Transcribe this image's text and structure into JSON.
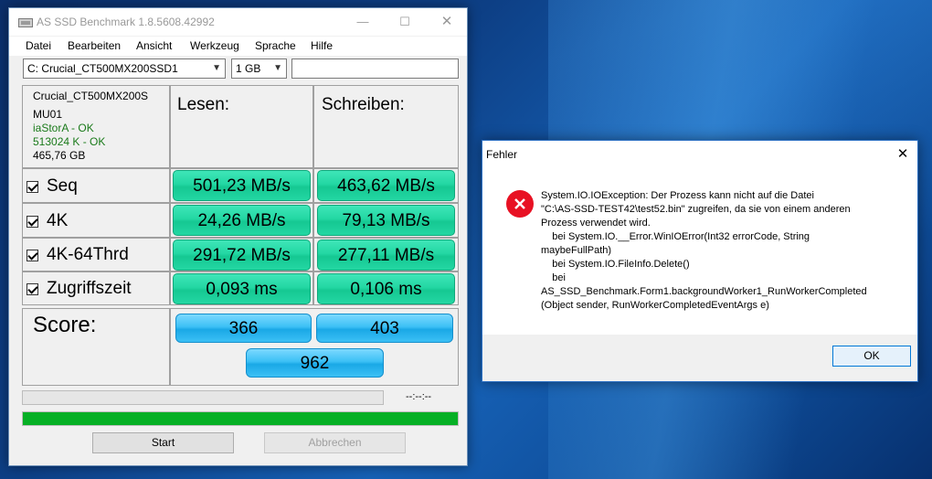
{
  "main_window": {
    "title": "AS SSD Benchmark 1.8.5608.42992",
    "menu": [
      "Datei",
      "Bearbeiten",
      "Ansicht",
      "Werkzeug",
      "Sprache",
      "Hilfe"
    ],
    "drive_select": "C: Crucial_CT500MX200SSD1",
    "size_select": "1 GB",
    "name_field": "",
    "drive_info": {
      "model": "Crucial_CT500MX200S",
      "firmware": "MU01",
      "driver": "iaStorA - OK",
      "alignment": "513024 K - OK",
      "capacity": "465,76 GB"
    },
    "columns": {
      "read": "Lesen:",
      "write": "Schreiben:"
    },
    "rows": [
      {
        "label": "Seq",
        "read": "501,23 MB/s",
        "write": "463,62 MB/s"
      },
      {
        "label": "4K",
        "read": "24,26 MB/s",
        "write": "79,13 MB/s"
      },
      {
        "label": "4K-64Thrd",
        "read": "291,72 MB/s",
        "write": "277,11 MB/s"
      },
      {
        "label": "Zugriffszeit",
        "read": "0,093 ms",
        "write": "0,106 ms"
      }
    ],
    "score": {
      "label": "Score:",
      "read": "366",
      "write": "403",
      "total": "962"
    },
    "elapsed_time": "--:--:--",
    "progress_fraction": 1.0,
    "buttons": {
      "start": "Start",
      "cancel": "Abbrechen"
    }
  },
  "error_dialog": {
    "title": "Fehler",
    "message_lines": [
      "System.IO.IOException: Der Prozess kann nicht auf die Datei",
      "\"C:\\AS-SSD-TEST42\\test52.bin\" zugreifen, da sie von einem anderen",
      "Prozess verwendet wird.",
      "    bei System.IO.__Error.WinIOError(Int32 errorCode, String",
      "maybeFullPath)",
      "    bei System.IO.FileInfo.Delete()",
      "    bei",
      "AS_SSD_Benchmark.Form1.backgroundWorker1_RunWorkerCompleted",
      "(Object sender, RunWorkerCompletedEventArgs e)"
    ],
    "ok_label": "OK"
  },
  "colors": {
    "result_green": "#23d7a3",
    "score_blue": "#3cc0f5",
    "progress_green": "#06b025",
    "error_red": "#e81123",
    "info_green": "#1a7a1a"
  }
}
